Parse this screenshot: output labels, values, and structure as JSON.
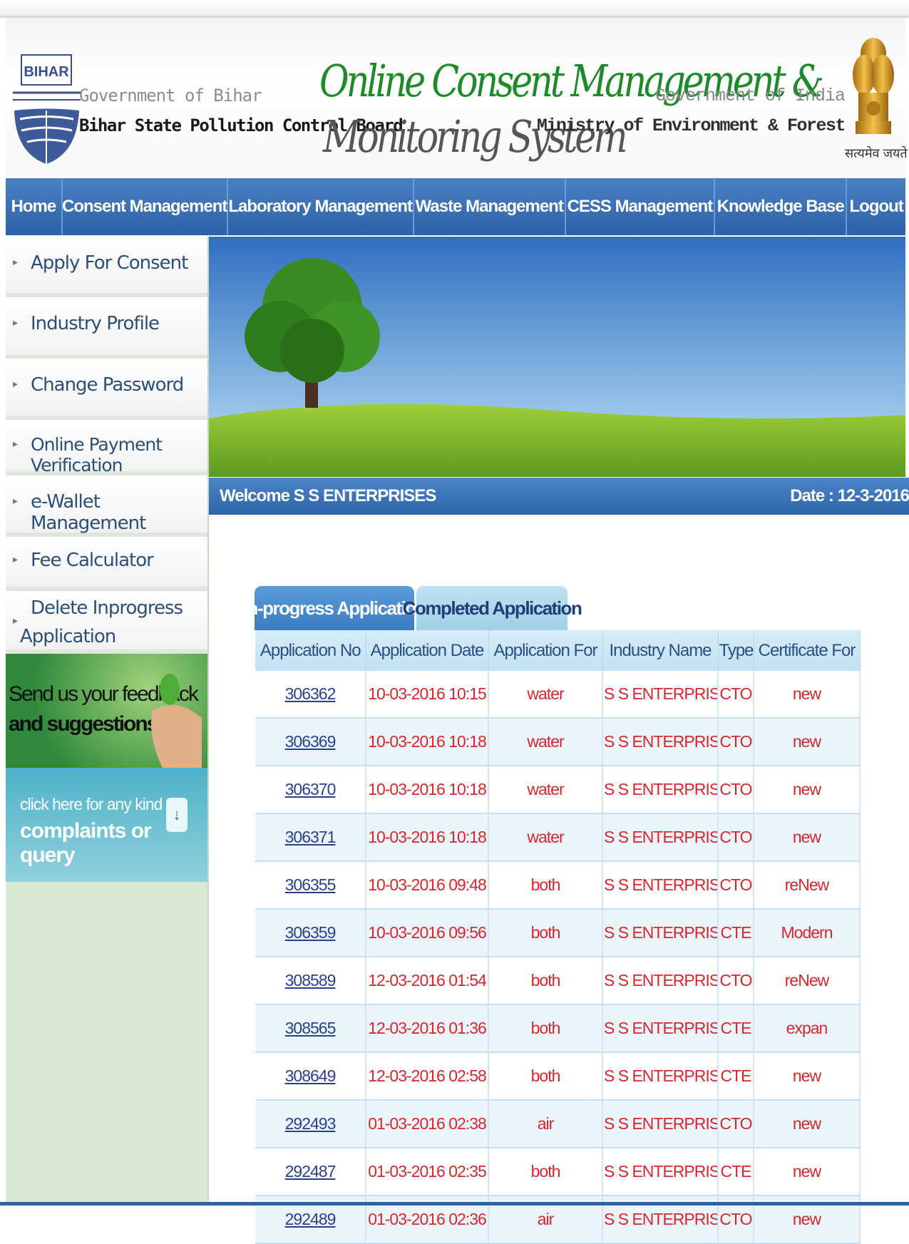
{
  "header": {
    "bihar_logo_text": "BIHAR",
    "gov_bihar": "Government of Bihar",
    "board_name": "Bihar State Pollution Control Board",
    "title_line1": "Online Consent Management &",
    "title_line2": "Monitoring System",
    "gov_india": "Government of India",
    "ministry": "Ministry of Environment & Forest",
    "emblem_caption": "सत्यमेव जयते"
  },
  "nav": {
    "items": [
      {
        "label": "Home"
      },
      {
        "label": "Consent Management"
      },
      {
        "label": "Laboratory Management"
      },
      {
        "label": "Waste Management"
      },
      {
        "label": "CESS Management"
      },
      {
        "label": "Knowledge Base"
      },
      {
        "label": "Logout"
      }
    ]
  },
  "sidebar": {
    "items": [
      {
        "label": "Apply For Consent"
      },
      {
        "label": "Industry Profile"
      },
      {
        "label": "Change Password"
      },
      {
        "label": "Online Payment Verification"
      },
      {
        "label": "e-Wallet Management"
      },
      {
        "label": "Fee Calculator"
      },
      {
        "label": "Delete Inprogress Application"
      }
    ],
    "feedback": {
      "line1": "Send us your feedback",
      "line2": "and suggestions"
    },
    "complaints": {
      "line1": "click here for any kind",
      "line2": "complaints or query"
    }
  },
  "welcome": {
    "text": "Welcome S S ENTERPRISES",
    "date": "Date : 12-3-2016"
  },
  "tabs": [
    {
      "label": "In-progress Application",
      "active": true
    },
    {
      "label": "Completed Application",
      "active": false
    }
  ],
  "table": {
    "headers": [
      "Application No",
      "Application Date",
      "Application For",
      "Industry Name",
      "Type",
      "Certificate For"
    ],
    "rows": [
      [
        "306362",
        "10-03-2016 10:15",
        "water",
        "S S ENTERPRISES",
        "CTO",
        "new"
      ],
      [
        "306369",
        "10-03-2016 10:18",
        "water",
        "S S ENTERPRISES",
        "CTO",
        "new"
      ],
      [
        "306370",
        "10-03-2016 10:18",
        "water",
        "S S ENTERPRISES",
        "CTO",
        "new"
      ],
      [
        "306371",
        "10-03-2016 10:18",
        "water",
        "S S ENTERPRISES",
        "CTO",
        "new"
      ],
      [
        "306355",
        "10-03-2016 09:48",
        "both",
        "S S ENTERPRISES",
        "CTO",
        "reNew"
      ],
      [
        "306359",
        "10-03-2016 09:56",
        "both",
        "S S ENTERPRISES",
        "CTE",
        "Modern"
      ],
      [
        "308589",
        "12-03-2016 01:54",
        "both",
        "S S ENTERPRISES",
        "CTO",
        "reNew"
      ],
      [
        "308565",
        "12-03-2016 01:36",
        "both",
        "S S ENTERPRISES",
        "CTE",
        "expan"
      ],
      [
        "308649",
        "12-03-2016 02:58",
        "both",
        "S S ENTERPRISES",
        "CTE",
        "new"
      ],
      [
        "292493",
        "01-03-2016 02:38",
        "air",
        "S S ENTERPRISES",
        "CTO",
        "new"
      ],
      [
        "292487",
        "01-03-2016 02:35",
        "both",
        "S S ENTERPRISES",
        "CTE",
        "new"
      ],
      [
        "292489",
        "01-03-2016 02:36",
        "air",
        "S S ENTERPRISES",
        "CTO",
        "new"
      ]
    ]
  },
  "colors": {
    "nav_blue": "#2d62a8",
    "title_green": "#1f8a2a",
    "cell_red": "#d7262d",
    "link_blue": "#2b3f8f"
  }
}
